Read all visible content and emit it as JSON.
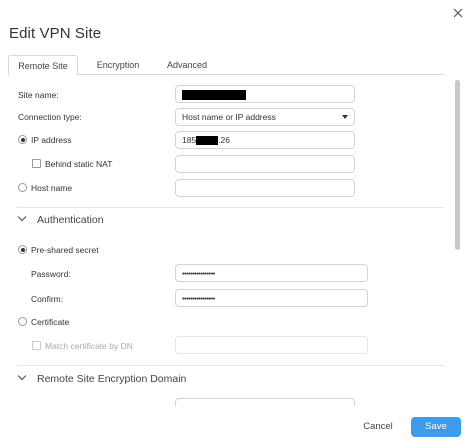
{
  "dialog": {
    "title": "Edit VPN Site",
    "close_icon": "close-icon"
  },
  "tabs": [
    {
      "label": "Remote Site",
      "active": true
    },
    {
      "label": "Encryption",
      "active": false
    },
    {
      "label": "Advanced",
      "active": false
    }
  ],
  "remote_site": {
    "site_name_label": "Site name:",
    "site_name_value": "",
    "connection_type_label": "Connection type:",
    "connection_type_value": "Host name or IP address",
    "ip_address_label": "IP address",
    "ip_address_prefix": "185",
    "ip_address_suffix": ".26",
    "behind_nat_label": "Behind static NAT",
    "behind_nat_value": "",
    "host_name_label": "Host name",
    "host_name_value": ""
  },
  "authentication": {
    "section_title": "Authentication",
    "preshared_label": "Pre-shared secret",
    "password_label": "Password:",
    "password_value": "••••••••••••••••",
    "confirm_label": "Confirm:",
    "confirm_value": "••••••••••••••••",
    "certificate_label": "Certificate",
    "match_cert_label": "Match certificate by DN",
    "match_cert_value": ""
  },
  "encryption_domain": {
    "section_title": "Remote Site Encryption Domain"
  },
  "footer": {
    "cancel_label": "Cancel",
    "save_label": "Save"
  },
  "colors": {
    "accent": "#3d9be9",
    "border": "#cfd4da",
    "text": "#333333"
  }
}
